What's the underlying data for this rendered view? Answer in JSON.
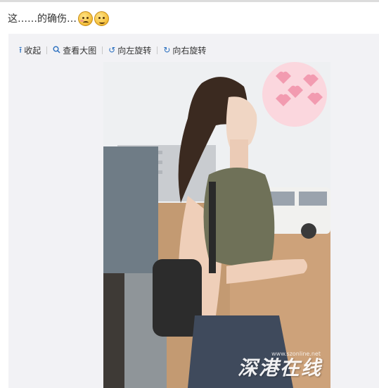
{
  "post": {
    "text": "这……的确伤…",
    "emojis": [
      "smirk-emoji",
      "worried-emoji"
    ]
  },
  "toolbar": {
    "collapse": "收起",
    "view_large": "查看大图",
    "rotate_left": "向左旋转",
    "rotate_right": "向右旋转"
  },
  "image": {
    "watermark": "深港在线",
    "watermark_url": "www.szonline.net"
  },
  "colors": {
    "accent": "#2a6fbf",
    "panel_bg": "#f2f2f5"
  }
}
